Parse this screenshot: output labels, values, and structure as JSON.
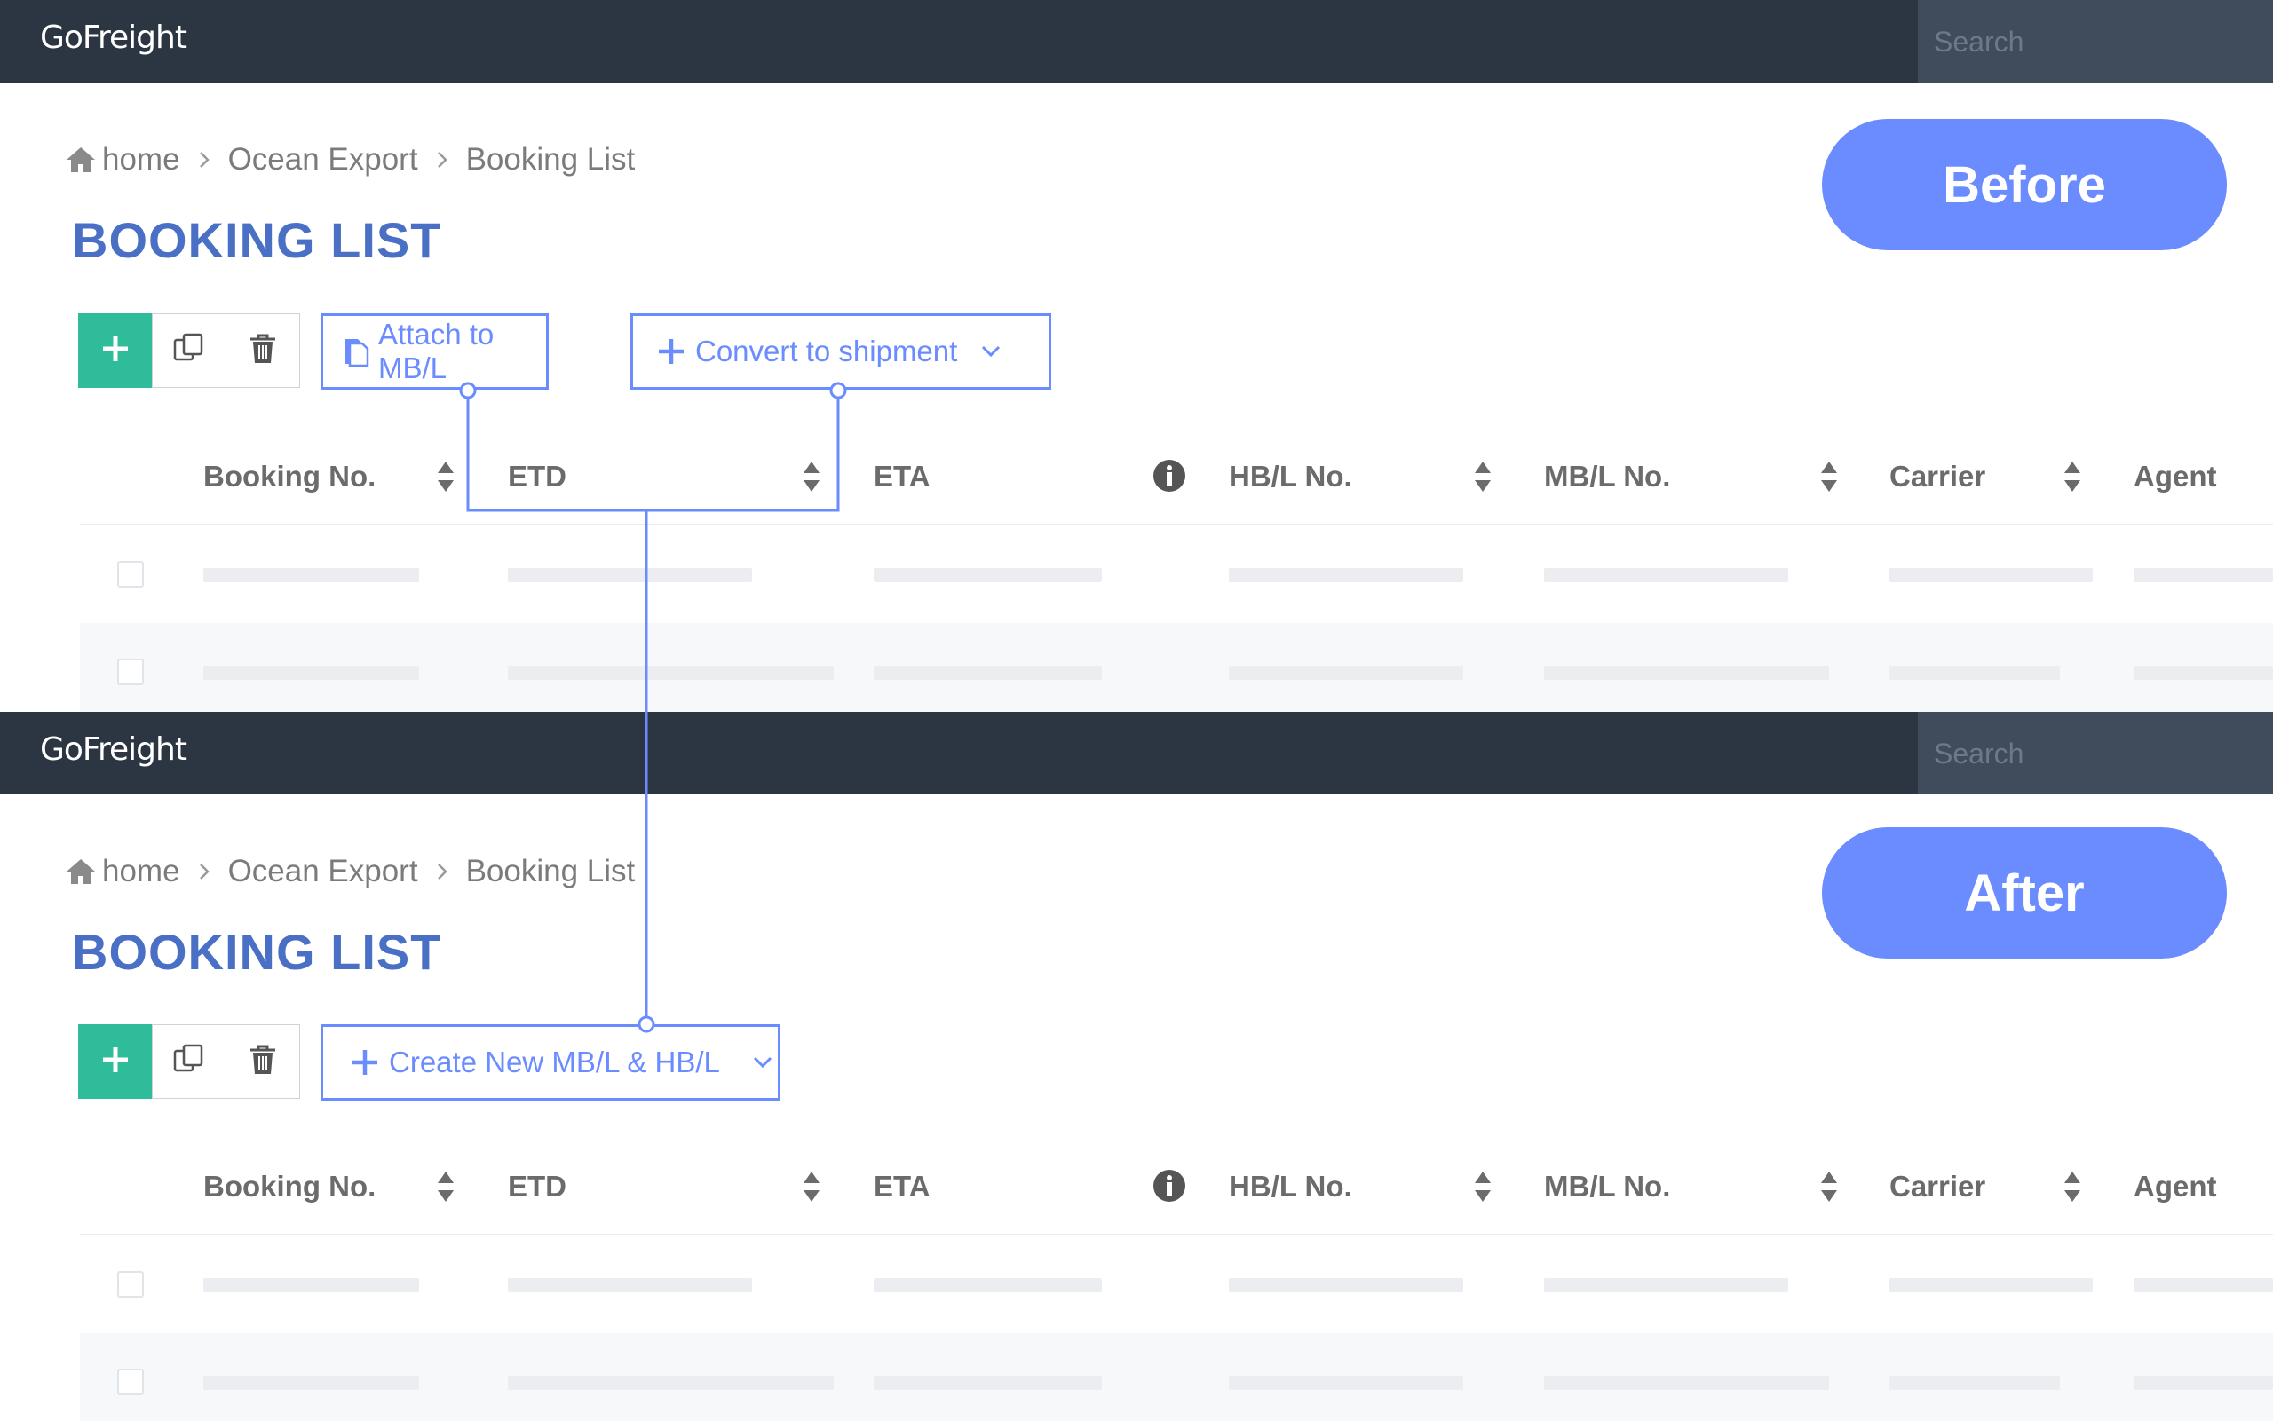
{
  "brand": "GoFreight",
  "search": {
    "placeholder": "Search"
  },
  "breadcrumb": [
    "home",
    "Ocean Export",
    "Booking List"
  ],
  "page_title": "BOOKING LIST",
  "columns": [
    "Booking No.",
    "ETD",
    "ETA",
    "HB/L No.",
    "MB/L No.",
    "Carrier",
    "Agent"
  ],
  "colors": {
    "topbar": "#2c3542",
    "accent": "#6b8cff",
    "title": "#4a70c6",
    "add_button": "#2fbc9a"
  },
  "icons": [
    "home-icon",
    "chevron-right-icon",
    "plus-icon",
    "copy-icon",
    "trash-icon",
    "document-icon",
    "chevron-down-icon",
    "sort-icon",
    "info-icon"
  ],
  "before": {
    "label": "Before",
    "actions": {
      "attach": "Attach to MB/L",
      "convert": "Convert to shipment"
    }
  },
  "after": {
    "label": "After",
    "actions": {
      "create": "Create New MB/L & HB/L"
    }
  }
}
